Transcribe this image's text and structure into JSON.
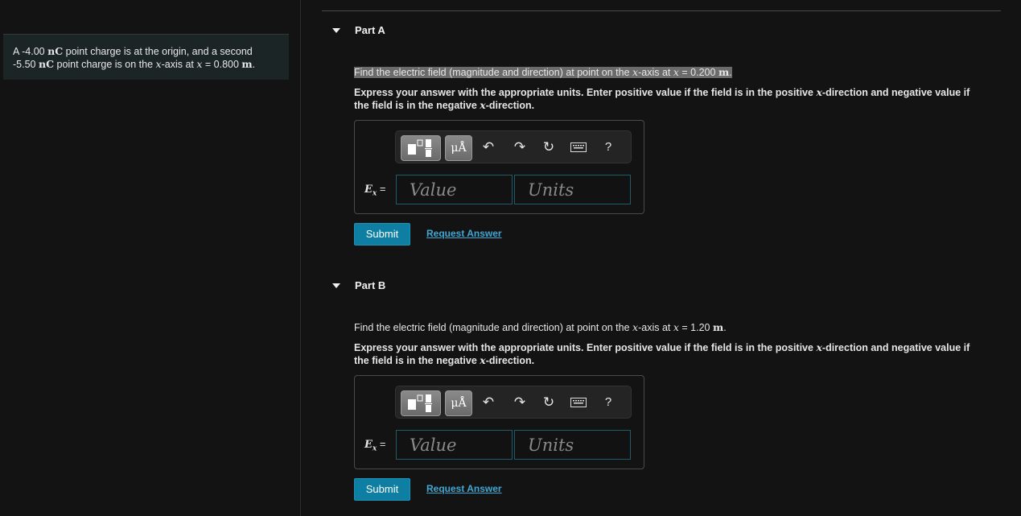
{
  "problem": {
    "line1_prefix": "A -4.00",
    "line1_unit": "nC",
    "line1_suffix": " point charge is at the origin, and a second",
    "line2_prefix": "-5.50",
    "line2_unit": "nC",
    "line2_mid": " point charge is on the ",
    "line2_var": "x",
    "line2_axis": "-axis at ",
    "line2_var2": "x",
    "line2_eq": " = 0.800 ",
    "line2_m": "m",
    "line2_end": "."
  },
  "parts": [
    {
      "title": "Part A",
      "question_prefix": "Find the electric field (magnitude and direction) at point on the ",
      "question_var": "x",
      "question_axis": "-axis at ",
      "question_var2": "x",
      "question_eq": " = 0.200 ",
      "question_unit": "m",
      "question_end": ".",
      "instructions_1": "Express your answer with the appropriate units. Enter positive value if the field is in the positive ",
      "instructions_var": "x",
      "instructions_2": "-direction and negative value if",
      "instructions_3": "the field is in the negative ",
      "instructions_var2": "x",
      "instructions_4": "-direction.",
      "label_var": "E",
      "label_sub": "x",
      "label_eq": " =",
      "value_placeholder": "Value",
      "units_placeholder": "Units",
      "submit": "Submit",
      "request": "Request Answer"
    },
    {
      "title": "Part B",
      "question_prefix": "Find the electric field (magnitude and direction) at point on the ",
      "question_var": "x",
      "question_axis": "-axis at ",
      "question_var2": "x",
      "question_eq": " = 1.20 ",
      "question_unit": "m",
      "question_end": ".",
      "instructions_1": "Express your answer with the appropriate units. Enter positive value if the field is in the positive ",
      "instructions_var": "x",
      "instructions_2": "-direction and negative value if",
      "instructions_3": "the field is in the negative ",
      "instructions_var2": "x",
      "instructions_4": "-direction.",
      "label_var": "E",
      "label_sub": "x",
      "label_eq": " =",
      "value_placeholder": "Value",
      "units_placeholder": "Units",
      "submit": "Submit",
      "request": "Request Answer"
    }
  ],
  "toolbar": {
    "units_label": "μÅ",
    "undo": "↶",
    "redo": "↷",
    "reset": "↻",
    "help": "?"
  },
  "colors": {
    "accent": "#0e7ea2",
    "link": "#3fa8d3",
    "field_border": "#1f5b6b"
  }
}
